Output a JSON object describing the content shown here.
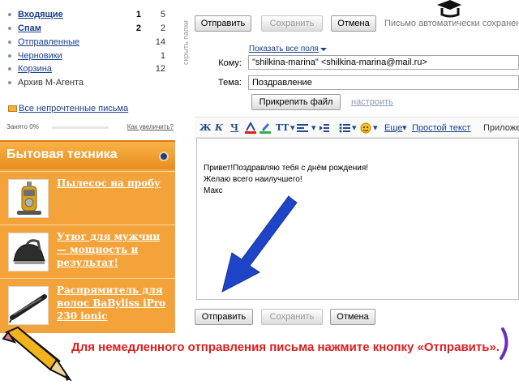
{
  "folders": {
    "items": [
      {
        "name": "Входящие",
        "unread": "1",
        "total": "5"
      },
      {
        "name": "Спам",
        "unread": "2",
        "total": "2"
      },
      {
        "name": "Отправленные",
        "unread": "",
        "total": "14"
      },
      {
        "name": "Черновики",
        "unread": "",
        "total": "1"
      },
      {
        "name": "Корзина",
        "unread": "",
        "total": "12"
      },
      {
        "name": "Архив М-Агента",
        "unread": "",
        "total": ""
      }
    ],
    "all_unread": "Все непрочтенные письма",
    "quota": "Занято 0%",
    "quota_link": "Как увеличить?"
  },
  "hide_folders": "скрыть папки",
  "ad": {
    "title": "Бытовая техника",
    "items": [
      {
        "text": "Пылесос на пробу"
      },
      {
        "text": "Утюг для мужчин — мощность и результат!"
      },
      {
        "text": "Распрямитель для волос BaByliss iPro 230 ionic"
      }
    ]
  },
  "toolbar": {
    "send": "Отправить",
    "save": "Сохранить",
    "cancel": "Отмена",
    "autosave": "Письмо автоматически сохранен"
  },
  "compose": {
    "show_fields": "Показать все поля",
    "to_label": "Кому:",
    "to_value": "\"shilkina-marina\" <shilkina-marina@mail.ru>",
    "subject_label": "Тема:",
    "subject_value": "Поздравление",
    "attach": "Прикрепить файл",
    "settings": "настроить"
  },
  "format_bar": {
    "bold": "Ж",
    "italic": "К",
    "underline": "Ч",
    "font": "ТТ",
    "more": "Еще",
    "plain_text": "Простой текст",
    "apps": "Приложен"
  },
  "body_text": "Привет!Поздравляю тебя с днём рождения!\nЖелаю всего наилучшего!\nМакс",
  "bottom_toolbar": {
    "send": "Отправить",
    "save": "Сохранить",
    "cancel": "Отмена"
  },
  "caption": "Для немедленного отправления письма нажмите кнопку «Отправить».",
  "colors": {
    "accent_blue": "#1e44c8",
    "ad_orange": "#f3a33a",
    "caption_red": "#e21b1b",
    "link_blue": "#1a3f8c"
  }
}
